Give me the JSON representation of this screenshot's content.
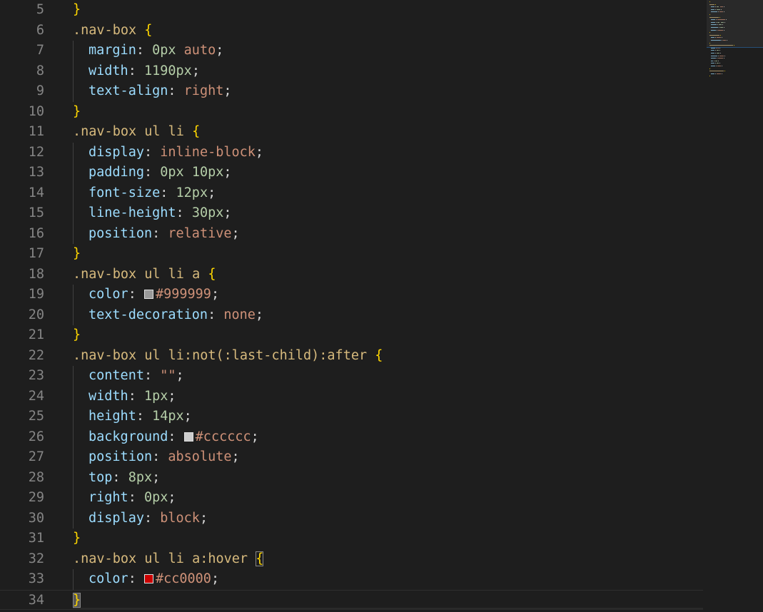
{
  "editor": {
    "language": "css",
    "colors": {
      "background": "#1e1e1e",
      "line_number": "#858585",
      "brace": "#ffd700",
      "selector": "#d7ba7d",
      "property": "#9cdcfe",
      "number": "#b5cea8",
      "string": "#ce9178"
    },
    "lines": [
      {
        "n": "5",
        "indent": false,
        "tokens": [
          {
            "t": "}",
            "c": "brace"
          }
        ]
      },
      {
        "n": "6",
        "indent": false,
        "tokens": [
          {
            "t": ".nav-box ",
            "c": "sel"
          },
          {
            "t": "{",
            "c": "brace"
          }
        ]
      },
      {
        "n": "7",
        "indent": true,
        "tokens": [
          {
            "t": "margin",
            "c": "prop"
          },
          {
            "t": ": ",
            "c": "punc"
          },
          {
            "t": "0px",
            "c": "num"
          },
          {
            "t": " ",
            "c": "punc"
          },
          {
            "t": "auto",
            "c": "str"
          },
          {
            "t": ";",
            "c": "punc"
          }
        ]
      },
      {
        "n": "8",
        "indent": true,
        "tokens": [
          {
            "t": "width",
            "c": "prop"
          },
          {
            "t": ": ",
            "c": "punc"
          },
          {
            "t": "1190px",
            "c": "num"
          },
          {
            "t": ";",
            "c": "punc"
          }
        ]
      },
      {
        "n": "9",
        "indent": true,
        "tokens": [
          {
            "t": "text-align",
            "c": "prop"
          },
          {
            "t": ": ",
            "c": "punc"
          },
          {
            "t": "right",
            "c": "str"
          },
          {
            "t": ";",
            "c": "punc"
          }
        ]
      },
      {
        "n": "10",
        "indent": false,
        "tokens": [
          {
            "t": "}",
            "c": "brace"
          }
        ]
      },
      {
        "n": "11",
        "indent": false,
        "tokens": [
          {
            "t": ".nav-box ul li ",
            "c": "sel"
          },
          {
            "t": "{",
            "c": "brace"
          }
        ]
      },
      {
        "n": "12",
        "indent": true,
        "tokens": [
          {
            "t": "display",
            "c": "prop"
          },
          {
            "t": ": ",
            "c": "punc"
          },
          {
            "t": "inline-block",
            "c": "str"
          },
          {
            "t": ";",
            "c": "punc"
          }
        ]
      },
      {
        "n": "13",
        "indent": true,
        "tokens": [
          {
            "t": "padding",
            "c": "prop"
          },
          {
            "t": ": ",
            "c": "punc"
          },
          {
            "t": "0px",
            "c": "num"
          },
          {
            "t": " ",
            "c": "punc"
          },
          {
            "t": "10px",
            "c": "num"
          },
          {
            "t": ";",
            "c": "punc"
          }
        ]
      },
      {
        "n": "14",
        "indent": true,
        "tokens": [
          {
            "t": "font-size",
            "c": "prop"
          },
          {
            "t": ": ",
            "c": "punc"
          },
          {
            "t": "12px",
            "c": "num"
          },
          {
            "t": ";",
            "c": "punc"
          }
        ]
      },
      {
        "n": "15",
        "indent": true,
        "tokens": [
          {
            "t": "line-height",
            "c": "prop"
          },
          {
            "t": ": ",
            "c": "punc"
          },
          {
            "t": "30px",
            "c": "num"
          },
          {
            "t": ";",
            "c": "punc"
          }
        ]
      },
      {
        "n": "16",
        "indent": true,
        "tokens": [
          {
            "t": "position",
            "c": "prop"
          },
          {
            "t": ": ",
            "c": "punc"
          },
          {
            "t": "relative",
            "c": "str"
          },
          {
            "t": ";",
            "c": "punc"
          }
        ]
      },
      {
        "n": "17",
        "indent": false,
        "tokens": [
          {
            "t": "}",
            "c": "brace"
          }
        ]
      },
      {
        "n": "18",
        "indent": false,
        "tokens": [
          {
            "t": ".nav-box ul li a ",
            "c": "sel"
          },
          {
            "t": "{",
            "c": "brace"
          }
        ]
      },
      {
        "n": "19",
        "indent": true,
        "tokens": [
          {
            "t": "color",
            "c": "prop"
          },
          {
            "t": ": ",
            "c": "punc"
          },
          {
            "swatch": "#999999"
          },
          {
            "t": "#999999",
            "c": "str"
          },
          {
            "t": ";",
            "c": "punc"
          }
        ]
      },
      {
        "n": "20",
        "indent": true,
        "tokens": [
          {
            "t": "text-decoration",
            "c": "prop"
          },
          {
            "t": ": ",
            "c": "punc"
          },
          {
            "t": "none",
            "c": "str"
          },
          {
            "t": ";",
            "c": "punc"
          }
        ]
      },
      {
        "n": "21",
        "indent": false,
        "tokens": [
          {
            "t": "}",
            "c": "brace"
          }
        ]
      },
      {
        "n": "22",
        "indent": false,
        "tokens": [
          {
            "t": ".nav-box ul li:not(:last-child):after ",
            "c": "sel"
          },
          {
            "t": "{",
            "c": "brace"
          }
        ]
      },
      {
        "n": "23",
        "indent": true,
        "tokens": [
          {
            "t": "content",
            "c": "prop"
          },
          {
            "t": ": ",
            "c": "punc"
          },
          {
            "t": "\"\"",
            "c": "str"
          },
          {
            "t": ";",
            "c": "punc"
          }
        ]
      },
      {
        "n": "24",
        "indent": true,
        "tokens": [
          {
            "t": "width",
            "c": "prop"
          },
          {
            "t": ": ",
            "c": "punc"
          },
          {
            "t": "1px",
            "c": "num"
          },
          {
            "t": ";",
            "c": "punc"
          }
        ]
      },
      {
        "n": "25",
        "indent": true,
        "tokens": [
          {
            "t": "height",
            "c": "prop"
          },
          {
            "t": ": ",
            "c": "punc"
          },
          {
            "t": "14px",
            "c": "num"
          },
          {
            "t": ";",
            "c": "punc"
          }
        ]
      },
      {
        "n": "26",
        "indent": true,
        "tokens": [
          {
            "t": "background",
            "c": "prop"
          },
          {
            "t": ": ",
            "c": "punc"
          },
          {
            "swatch": "#cccccc"
          },
          {
            "t": "#cccccc",
            "c": "str"
          },
          {
            "t": ";",
            "c": "punc"
          }
        ]
      },
      {
        "n": "27",
        "indent": true,
        "tokens": [
          {
            "t": "position",
            "c": "prop"
          },
          {
            "t": ": ",
            "c": "punc"
          },
          {
            "t": "absolute",
            "c": "str"
          },
          {
            "t": ";",
            "c": "punc"
          }
        ]
      },
      {
        "n": "28",
        "indent": true,
        "tokens": [
          {
            "t": "top",
            "c": "prop"
          },
          {
            "t": ": ",
            "c": "punc"
          },
          {
            "t": "8px",
            "c": "num"
          },
          {
            "t": ";",
            "c": "punc"
          }
        ]
      },
      {
        "n": "29",
        "indent": true,
        "tokens": [
          {
            "t": "right",
            "c": "prop"
          },
          {
            "t": ": ",
            "c": "punc"
          },
          {
            "t": "0px",
            "c": "num"
          },
          {
            "t": ";",
            "c": "punc"
          }
        ]
      },
      {
        "n": "30",
        "indent": true,
        "tokens": [
          {
            "t": "display",
            "c": "prop"
          },
          {
            "t": ": ",
            "c": "punc"
          },
          {
            "t": "block",
            "c": "str"
          },
          {
            "t": ";",
            "c": "punc"
          }
        ]
      },
      {
        "n": "31",
        "indent": false,
        "tokens": [
          {
            "t": "}",
            "c": "brace"
          }
        ]
      },
      {
        "n": "32",
        "indent": false,
        "tokens": [
          {
            "t": ".nav-box ul li a:hover ",
            "c": "sel"
          },
          {
            "t": "{",
            "c": "brace",
            "match": true
          }
        ]
      },
      {
        "n": "33",
        "indent": true,
        "tokens": [
          {
            "t": "color",
            "c": "prop"
          },
          {
            "t": ": ",
            "c": "punc"
          },
          {
            "swatch": "#cc0000"
          },
          {
            "t": "#cc0000",
            "c": "str"
          },
          {
            "t": ";",
            "c": "punc"
          }
        ]
      },
      {
        "n": "34",
        "indent": false,
        "current": true,
        "tokens": [
          {
            "t": "}",
            "c": "brace",
            "cursor": true
          }
        ]
      }
    ]
  }
}
